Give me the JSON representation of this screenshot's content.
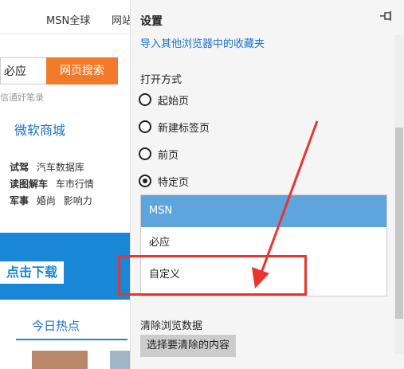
{
  "background": {
    "nav_msn": "MSN全球",
    "nav_net": "网站",
    "search_engine": "必应",
    "search_button": "网页搜索",
    "search_hint": "信通奸笔录",
    "mall": "微软商城",
    "link_rows": [
      {
        "bold": "试驾",
        "items": [
          "汽车数据库"
        ]
      },
      {
        "bold": "读图解车",
        "items": [
          "车市行情"
        ]
      },
      {
        "bold": "军事",
        "items": [
          "婚尚",
          "影响力"
        ]
      }
    ],
    "banner_text": "点击下载",
    "hot_title": "今日热点"
  },
  "panel": {
    "title": "设置",
    "pin_icon": "pin-icon",
    "import_link": "导入其他浏览器中的收藏夹",
    "open_with_label": "打开方式",
    "options": [
      {
        "label": "起始页",
        "checked": false
      },
      {
        "label": "新建标签页",
        "checked": false
      },
      {
        "label": "前页",
        "checked": false
      },
      {
        "label": "特定页",
        "checked": true
      }
    ],
    "page_list": [
      {
        "label": "MSN",
        "selected": true
      },
      {
        "label": "必应",
        "selected": false
      },
      {
        "label": "自定义",
        "selected": false
      }
    ],
    "clear_label": "清除浏览数据",
    "clear_button": "选择要清除的内容"
  },
  "colors": {
    "accent": "#1a73c8",
    "selected": "#5ea4dd",
    "highlight": "#e8352e",
    "search_button": "#f27a2a"
  }
}
